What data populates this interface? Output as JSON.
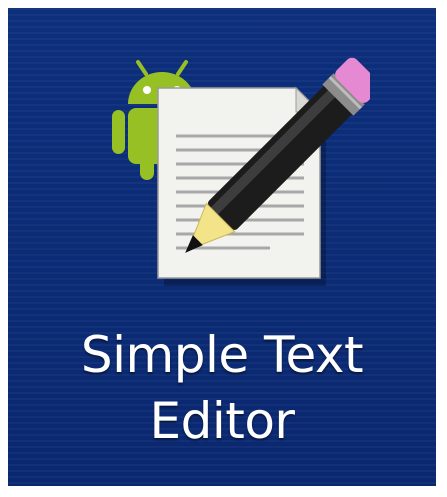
{
  "app": {
    "title_line1": "Simple Text",
    "title_line2": "Editor"
  },
  "icons": {
    "app_icon": "text-editor-icon",
    "mascot": "android-icon",
    "document": "document-icon",
    "pencil": "pencil-icon"
  },
  "colors": {
    "background": "#0b2a73",
    "android_green": "#97c024",
    "paper": "#f2f2ee",
    "pencil_body": "#1a1a1a",
    "eraser": "#e58ad2",
    "pencil_wood": "#f3e48a"
  }
}
